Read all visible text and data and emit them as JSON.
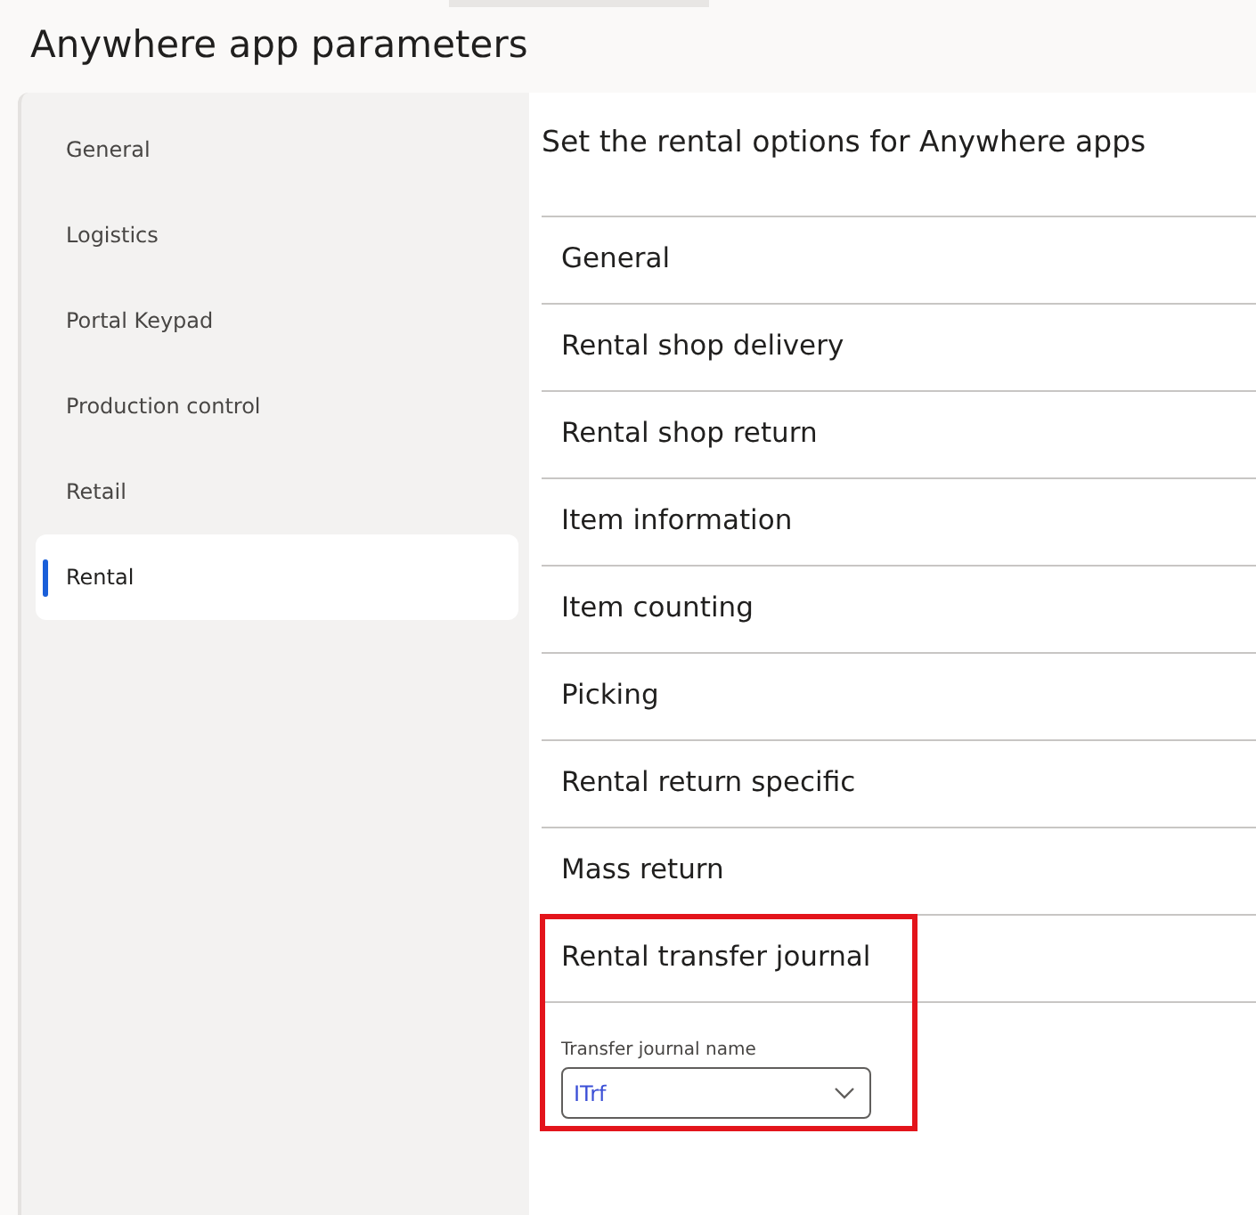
{
  "page_title": "Anywhere app parameters",
  "sidebar": {
    "items": [
      {
        "label": "General",
        "selected": false
      },
      {
        "label": "Logistics",
        "selected": false
      },
      {
        "label": "Portal Keypad",
        "selected": false
      },
      {
        "label": "Production control",
        "selected": false
      },
      {
        "label": "Retail",
        "selected": false
      },
      {
        "label": "Rental",
        "selected": true
      }
    ]
  },
  "content": {
    "heading": "Set the rental options for Anywhere apps",
    "sections": [
      {
        "title": "General",
        "highlighted": false
      },
      {
        "title": "Rental shop delivery",
        "highlighted": false
      },
      {
        "title": "Rental shop return",
        "highlighted": false
      },
      {
        "title": "Item information",
        "highlighted": false
      },
      {
        "title": "Item counting",
        "highlighted": false
      },
      {
        "title": "Picking",
        "highlighted": false
      },
      {
        "title": "Rental return specific",
        "highlighted": false
      },
      {
        "title": "Mass return",
        "highlighted": false
      },
      {
        "title": "Rental transfer journal",
        "highlighted": true,
        "field": {
          "label": "Transfer journal name",
          "value": "ITrf"
        }
      }
    ]
  }
}
